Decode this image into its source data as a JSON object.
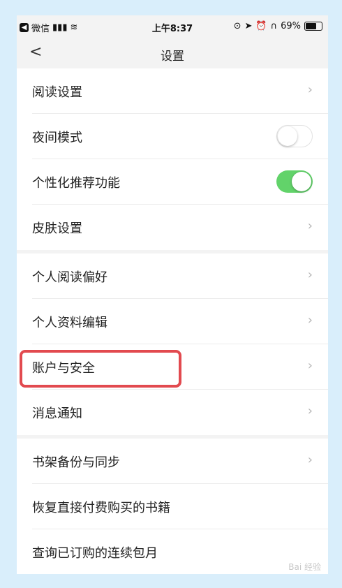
{
  "status_bar": {
    "carrier": "微信",
    "time": "上午8:37",
    "battery": "69%",
    "battery_level": 0.69
  },
  "nav": {
    "back_icon": "chevron-left-icon",
    "title": "设置"
  },
  "groups": [
    {
      "items": [
        {
          "label": "阅读设置",
          "type": "link"
        },
        {
          "label": "夜间模式",
          "type": "toggle",
          "value": false
        },
        {
          "label": "个性化推荐功能",
          "type": "toggle",
          "value": true
        },
        {
          "label": "皮肤设置",
          "type": "link"
        }
      ]
    },
    {
      "items": [
        {
          "label": "个人阅读偏好",
          "type": "link"
        },
        {
          "label": "个人资料编辑",
          "type": "link"
        },
        {
          "label": "账户与安全",
          "type": "link",
          "highlighted": true
        },
        {
          "label": "消息通知",
          "type": "link"
        }
      ]
    },
    {
      "items": [
        {
          "label": "书架备份与同步",
          "type": "link"
        },
        {
          "label": "恢复直接付费购买的书籍",
          "type": "link"
        },
        {
          "label": "查询已订购的连续包月",
          "type": "link"
        }
      ]
    }
  ],
  "colors": {
    "toggle_on": "#62d36a",
    "highlight": "#e24a4f",
    "background": "#f3f3f3"
  },
  "watermark": "Bai 经验"
}
